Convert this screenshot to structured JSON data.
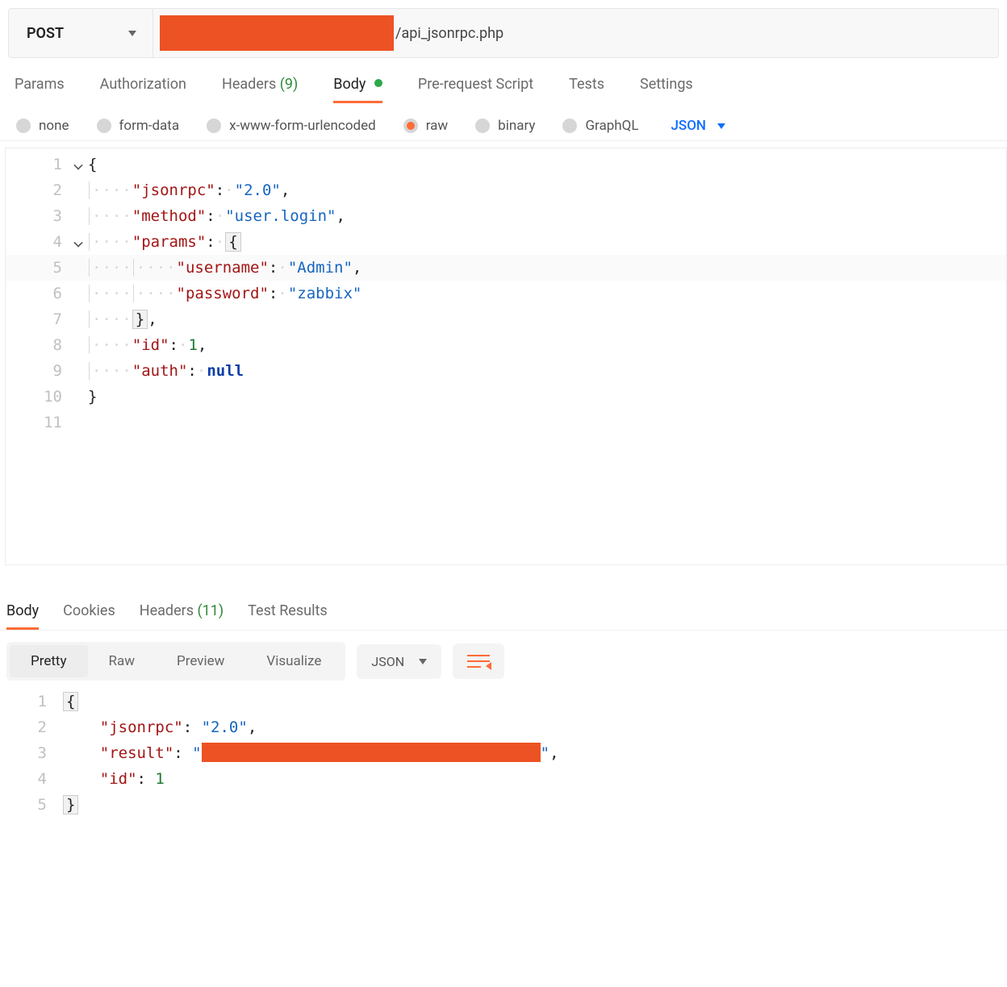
{
  "request": {
    "method": "POST",
    "url_suffix": "/api_jsonrpc.php"
  },
  "req_tabs": {
    "params": "Params",
    "auth": "Authorization",
    "headers_label": "Headers",
    "headers_count": "(9)",
    "body": "Body",
    "prerequest": "Pre-request Script",
    "tests": "Tests",
    "settings": "Settings"
  },
  "body_radios": {
    "none": "none",
    "form": "form-data",
    "urlenc": "x-www-form-urlencoded",
    "raw": "raw",
    "binary": "binary",
    "graphql": "GraphQL",
    "type_select": "JSON"
  },
  "req_body": {
    "l1_open": "{",
    "l2_key": "\"jsonrpc\"",
    "l2_val": "\"2.0\"",
    "l3_key": "\"method\"",
    "l3_val": "\"user.login\"",
    "l4_key": "\"params\"",
    "l4_open": "{",
    "l5_key": "\"username\"",
    "l5_val": "\"Admin\"",
    "l6_key": "\"password\"",
    "l6_val": "\"zabbix\"",
    "l7_close": "}",
    "l8_key": "\"id\"",
    "l8_val": "1",
    "l9_key": "\"auth\"",
    "l9_val": "null",
    "l10_close": "}"
  },
  "resp_tabs": {
    "body": "Body",
    "cookies": "Cookies",
    "headers_label": "Headers",
    "headers_count": "(11)",
    "test_results": "Test Results"
  },
  "resp_toolbar": {
    "pretty": "Pretty",
    "raw": "Raw",
    "preview": "Preview",
    "visualize": "Visualize",
    "type": "JSON"
  },
  "resp_body": {
    "l1_open": "{",
    "l2_key": "\"jsonrpc\"",
    "l2_val": "\"2.0\"",
    "l3_key": "\"result\"",
    "l3_open_q": "\"",
    "l3_close_q": "\"",
    "l4_key": "\"id\"",
    "l4_val": "1",
    "l5_close": "}"
  }
}
